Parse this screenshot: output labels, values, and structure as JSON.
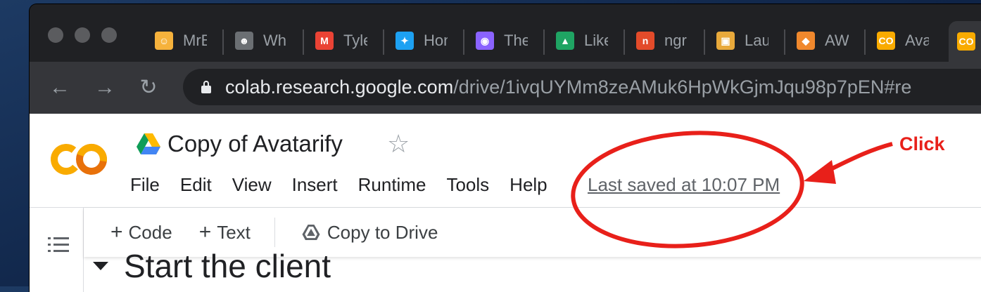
{
  "browser": {
    "tabs": [
      {
        "title": "MrB",
        "icon": "trump-face-icon",
        "color": "#f6b23c"
      },
      {
        "title": "Wh",
        "icon": "person-photo-icon",
        "color": "#6b6f73"
      },
      {
        "title": "Tyle",
        "icon": "gmail-icon",
        "color": "#ea4335"
      },
      {
        "title": "Hon",
        "icon": "twitter-icon",
        "color": "#1da1f2"
      },
      {
        "title": "The",
        "icon": "anchor-podcast-icon",
        "color": "#8a63ff"
      },
      {
        "title": "Like",
        "icon": "google-drive-icon",
        "color": "#1fa463"
      },
      {
        "title": "ngr",
        "icon": "ngrok-icon",
        "color": "#e34b2a"
      },
      {
        "title": "Lau",
        "icon": "package-box-icon",
        "color": "#e8a93b"
      },
      {
        "title": "AW",
        "icon": "aws-cube-icon",
        "color": "#f0882d"
      },
      {
        "title": "Ava",
        "icon": "colab-icon",
        "color": "#f9ab00"
      },
      {
        "title": "",
        "icon": "colab-icon",
        "color": "#f9ab00",
        "active": true
      }
    ],
    "url_host": "colab.research.google.com",
    "url_path": "/drive/1ivqUYMm8zeAMuk6HpWkGjmJqu98p7pEN#re"
  },
  "notebook": {
    "logo_text": "CO",
    "title": "Copy of Avatarify",
    "menu": [
      "File",
      "Edit",
      "View",
      "Insert",
      "Runtime",
      "Tools",
      "Help"
    ],
    "last_saved": "Last saved at 10:07 PM",
    "actions": {
      "code": "Code",
      "text": "Text",
      "copy_to_drive": "Copy to Drive"
    },
    "section_heading": "Start the client"
  },
  "annotation": {
    "label": "Click",
    "color": "#e8201a"
  }
}
